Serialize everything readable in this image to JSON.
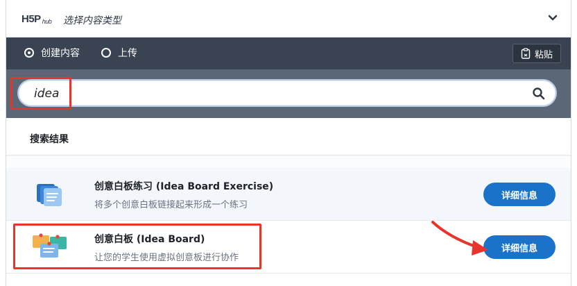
{
  "header": {
    "logo_text": "H5P",
    "logo_sub": "hub",
    "title": "选择内容类型",
    "collapse_icon": "chevron-down-icon"
  },
  "tabs": {
    "create_label": "创建内容",
    "upload_label": "上传",
    "paste_label": "粘贴",
    "paste_icon": "clipboard-icon"
  },
  "search": {
    "value": "idea",
    "icon": "search-icon"
  },
  "results": {
    "label": "搜索结果",
    "items": [
      {
        "title": "创意白板练习 (Idea Board Exercise)",
        "description": "将多个创意白板链接起来形成一个练习",
        "button_label": "详细信息",
        "icon": "idea-board-exercise-icon"
      },
      {
        "title": "创意白板 (Idea Board)",
        "description": "让您的学生使用虚拟创意板进行协作",
        "button_label": "详细信息",
        "icon": "idea-board-icon"
      }
    ]
  },
  "colors": {
    "tabbar_bg": "#3a4352",
    "search_band_bg": "#5b6676",
    "button_blue": "#1a73c8",
    "annotation_red": "#e8352b"
  }
}
